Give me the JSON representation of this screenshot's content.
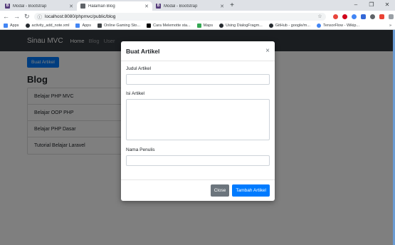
{
  "browser": {
    "tabs": [
      {
        "label": "Modal - Bootstrap",
        "icon": "B",
        "active": false
      },
      {
        "label": "Halaman Blog",
        "icon": "doc",
        "active": true
      },
      {
        "label": "Modal - Bootstrap",
        "icon": "B",
        "active": false
      }
    ],
    "new_tab": "+",
    "window_controls": {
      "minimize": "–",
      "maximize": "❐",
      "close": "✕"
    },
    "url": "localhost:8080/phpmvc/public/blog",
    "bookmarks": [
      {
        "label": "Apps",
        "color": "#4285f4"
      },
      {
        "label": "activity_add_note.xml",
        "color": "#24292e"
      },
      {
        "label": "Apps",
        "color": "#4285f4"
      },
      {
        "label": "Online Gaming Sto...",
        "color": "#3c4043"
      },
      {
        "label": "Cara Melemotte sta...",
        "color": "#000000"
      },
      {
        "label": "Maps",
        "color": "#34a853"
      },
      {
        "label": "Using DialogFragm...",
        "color": "#24292e"
      },
      {
        "label": "GitHub - google/m...",
        "color": "#24292e"
      },
      {
        "label": "TensorFlow - Wikip...",
        "color": "#4285f4"
      }
    ],
    "bookmarks_more": "»"
  },
  "site": {
    "brand": "Sinau MVC",
    "nav": [
      {
        "label": "Home",
        "active": true
      },
      {
        "label": "Blog",
        "active": false
      },
      {
        "label": "User",
        "active": false
      }
    ],
    "create_button": "Buat Artikel",
    "blog_title": "Blog",
    "articles": [
      "Belajar PHP MVC",
      "Belajar OOP PHP",
      "Belajar PHP Dasar",
      "Tutorial Belajar Laravel"
    ]
  },
  "modal": {
    "title": "Buat Artikel",
    "close_symbol": "×",
    "fields": {
      "judul_label": "Judul Artikel",
      "judul_value": "",
      "isi_label": "Isi Artikel",
      "isi_value": "",
      "penulis_label": "Nama Penulis",
      "penulis_value": ""
    },
    "close_button": "Close",
    "submit_button": "Tambah Artikel"
  },
  "colors": {
    "navbar": "#343a40",
    "primary": "#007bff",
    "secondary": "#6c757d",
    "bootstrap_favicon": "#563d7c"
  }
}
